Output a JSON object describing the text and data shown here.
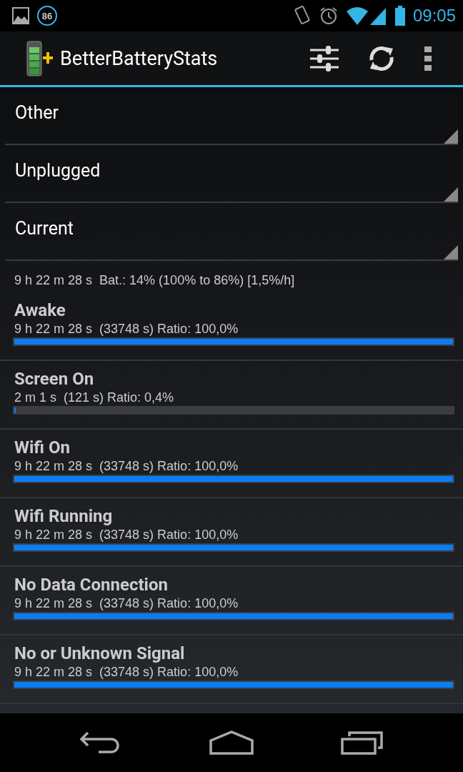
{
  "status_bar": {
    "notification_badge": "86",
    "time": "09:05"
  },
  "app_bar": {
    "title": "BetterBatteryStats"
  },
  "spinners": [
    {
      "value": "Other"
    },
    {
      "value": "Unplugged"
    },
    {
      "value": "Current"
    }
  ],
  "summary": "9 h 22 m 28 s  Bat.: 14% (100% to 86%) [1,5%/h]",
  "stats": [
    {
      "title": "Awake",
      "detail": "9 h 22 m 28 s  (33748 s) Ratio: 100,0%",
      "level": 1.0
    },
    {
      "title": "Screen On",
      "detail": "2 m 1 s  (121 s) Ratio: 0,4%",
      "level": 0.004
    },
    {
      "title": "Wifi On",
      "detail": "9 h 22 m 28 s  (33748 s) Ratio: 100,0%",
      "level": 1.0
    },
    {
      "title": "Wifi Running",
      "detail": "9 h 22 m 28 s  (33748 s) Ratio: 100,0%",
      "level": 1.0
    },
    {
      "title": "No Data Connection",
      "detail": "9 h 22 m 28 s  (33748 s) Ratio: 100,0%",
      "level": 1.0
    },
    {
      "title": "No or Unknown Signal",
      "detail": "9 h 22 m 28 s  (33748 s) Ratio: 100,0%",
      "level": 1.0
    }
  ]
}
